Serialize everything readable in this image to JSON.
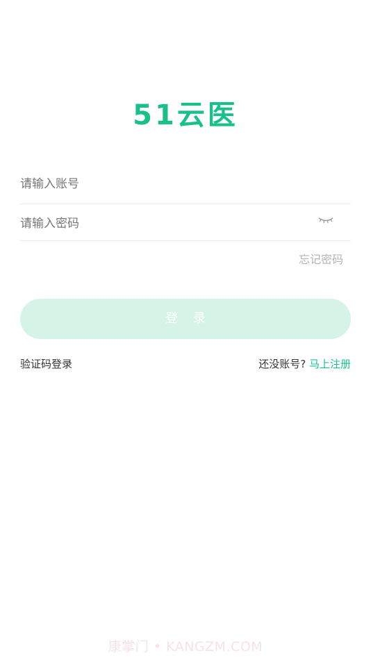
{
  "brand": {
    "name": "51云医",
    "color": "#19c08a"
  },
  "form": {
    "account_placeholder": "请输入账号",
    "password_placeholder": "请输入密码",
    "password_toggle_icon": "eye-closed-icon",
    "forgot_password": "忘记密码",
    "login_button": "登 录",
    "login_button_color": "#d5f3e7"
  },
  "footer_links": {
    "sms_login": "验证码登录",
    "no_account_prompt": "还没账号?",
    "register_link": "马上注册"
  },
  "watermark": {
    "text": "康掌门 • KANGZM.COM"
  }
}
